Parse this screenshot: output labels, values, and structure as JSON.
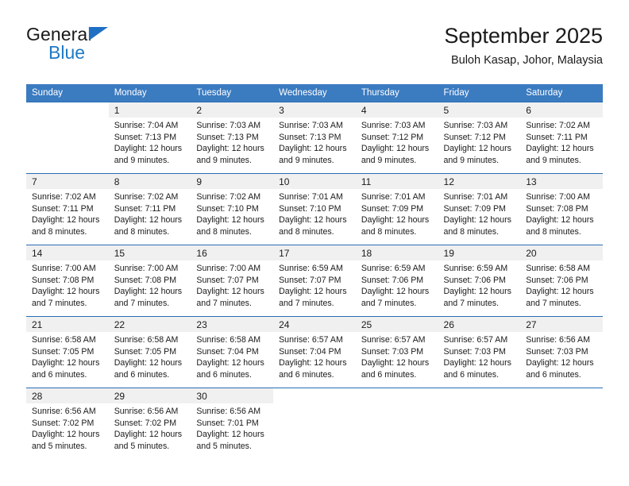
{
  "brand": {
    "name_top": "General",
    "name_bottom": "Blue",
    "triangle_icon": "triangle-icon"
  },
  "header": {
    "title": "September 2025",
    "subtitle": "Buloh Kasap, Johor, Malaysia"
  },
  "colors": {
    "header_blue": "#3b7bc0",
    "row_border_blue": "#2a6db5",
    "daynum_band": "#f0f0f0",
    "brand_blue": "#1f7ac4",
    "text": "#1a1a1a"
  },
  "weekday_headers": [
    "Sunday",
    "Monday",
    "Tuesday",
    "Wednesday",
    "Thursday",
    "Friday",
    "Saturday"
  ],
  "weeks": [
    [
      {
        "day": "",
        "lines": []
      },
      {
        "day": "1",
        "lines": [
          "Sunrise: 7:04 AM",
          "Sunset: 7:13 PM",
          "Daylight: 12 hours",
          "and 9 minutes."
        ]
      },
      {
        "day": "2",
        "lines": [
          "Sunrise: 7:03 AM",
          "Sunset: 7:13 PM",
          "Daylight: 12 hours",
          "and 9 minutes."
        ]
      },
      {
        "day": "3",
        "lines": [
          "Sunrise: 7:03 AM",
          "Sunset: 7:13 PM",
          "Daylight: 12 hours",
          "and 9 minutes."
        ]
      },
      {
        "day": "4",
        "lines": [
          "Sunrise: 7:03 AM",
          "Sunset: 7:12 PM",
          "Daylight: 12 hours",
          "and 9 minutes."
        ]
      },
      {
        "day": "5",
        "lines": [
          "Sunrise: 7:03 AM",
          "Sunset: 7:12 PM",
          "Daylight: 12 hours",
          "and 9 minutes."
        ]
      },
      {
        "day": "6",
        "lines": [
          "Sunrise: 7:02 AM",
          "Sunset: 7:11 PM",
          "Daylight: 12 hours",
          "and 9 minutes."
        ]
      }
    ],
    [
      {
        "day": "7",
        "lines": [
          "Sunrise: 7:02 AM",
          "Sunset: 7:11 PM",
          "Daylight: 12 hours",
          "and 8 minutes."
        ]
      },
      {
        "day": "8",
        "lines": [
          "Sunrise: 7:02 AM",
          "Sunset: 7:11 PM",
          "Daylight: 12 hours",
          "and 8 minutes."
        ]
      },
      {
        "day": "9",
        "lines": [
          "Sunrise: 7:02 AM",
          "Sunset: 7:10 PM",
          "Daylight: 12 hours",
          "and 8 minutes."
        ]
      },
      {
        "day": "10",
        "lines": [
          "Sunrise: 7:01 AM",
          "Sunset: 7:10 PM",
          "Daylight: 12 hours",
          "and 8 minutes."
        ]
      },
      {
        "day": "11",
        "lines": [
          "Sunrise: 7:01 AM",
          "Sunset: 7:09 PM",
          "Daylight: 12 hours",
          "and 8 minutes."
        ]
      },
      {
        "day": "12",
        "lines": [
          "Sunrise: 7:01 AM",
          "Sunset: 7:09 PM",
          "Daylight: 12 hours",
          "and 8 minutes."
        ]
      },
      {
        "day": "13",
        "lines": [
          "Sunrise: 7:00 AM",
          "Sunset: 7:08 PM",
          "Daylight: 12 hours",
          "and 8 minutes."
        ]
      }
    ],
    [
      {
        "day": "14",
        "lines": [
          "Sunrise: 7:00 AM",
          "Sunset: 7:08 PM",
          "Daylight: 12 hours",
          "and 7 minutes."
        ]
      },
      {
        "day": "15",
        "lines": [
          "Sunrise: 7:00 AM",
          "Sunset: 7:08 PM",
          "Daylight: 12 hours",
          "and 7 minutes."
        ]
      },
      {
        "day": "16",
        "lines": [
          "Sunrise: 7:00 AM",
          "Sunset: 7:07 PM",
          "Daylight: 12 hours",
          "and 7 minutes."
        ]
      },
      {
        "day": "17",
        "lines": [
          "Sunrise: 6:59 AM",
          "Sunset: 7:07 PM",
          "Daylight: 12 hours",
          "and 7 minutes."
        ]
      },
      {
        "day": "18",
        "lines": [
          "Sunrise: 6:59 AM",
          "Sunset: 7:06 PM",
          "Daylight: 12 hours",
          "and 7 minutes."
        ]
      },
      {
        "day": "19",
        "lines": [
          "Sunrise: 6:59 AM",
          "Sunset: 7:06 PM",
          "Daylight: 12 hours",
          "and 7 minutes."
        ]
      },
      {
        "day": "20",
        "lines": [
          "Sunrise: 6:58 AM",
          "Sunset: 7:06 PM",
          "Daylight: 12 hours",
          "and 7 minutes."
        ]
      }
    ],
    [
      {
        "day": "21",
        "lines": [
          "Sunrise: 6:58 AM",
          "Sunset: 7:05 PM",
          "Daylight: 12 hours",
          "and 6 minutes."
        ]
      },
      {
        "day": "22",
        "lines": [
          "Sunrise: 6:58 AM",
          "Sunset: 7:05 PM",
          "Daylight: 12 hours",
          "and 6 minutes."
        ]
      },
      {
        "day": "23",
        "lines": [
          "Sunrise: 6:58 AM",
          "Sunset: 7:04 PM",
          "Daylight: 12 hours",
          "and 6 minutes."
        ]
      },
      {
        "day": "24",
        "lines": [
          "Sunrise: 6:57 AM",
          "Sunset: 7:04 PM",
          "Daylight: 12 hours",
          "and 6 minutes."
        ]
      },
      {
        "day": "25",
        "lines": [
          "Sunrise: 6:57 AM",
          "Sunset: 7:03 PM",
          "Daylight: 12 hours",
          "and 6 minutes."
        ]
      },
      {
        "day": "26",
        "lines": [
          "Sunrise: 6:57 AM",
          "Sunset: 7:03 PM",
          "Daylight: 12 hours",
          "and 6 minutes."
        ]
      },
      {
        "day": "27",
        "lines": [
          "Sunrise: 6:56 AM",
          "Sunset: 7:03 PM",
          "Daylight: 12 hours",
          "and 6 minutes."
        ]
      }
    ],
    [
      {
        "day": "28",
        "lines": [
          "Sunrise: 6:56 AM",
          "Sunset: 7:02 PM",
          "Daylight: 12 hours",
          "and 5 minutes."
        ]
      },
      {
        "day": "29",
        "lines": [
          "Sunrise: 6:56 AM",
          "Sunset: 7:02 PM",
          "Daylight: 12 hours",
          "and 5 minutes."
        ]
      },
      {
        "day": "30",
        "lines": [
          "Sunrise: 6:56 AM",
          "Sunset: 7:01 PM",
          "Daylight: 12 hours",
          "and 5 minutes."
        ]
      },
      {
        "day": "",
        "lines": []
      },
      {
        "day": "",
        "lines": []
      },
      {
        "day": "",
        "lines": []
      },
      {
        "day": "",
        "lines": []
      }
    ]
  ]
}
